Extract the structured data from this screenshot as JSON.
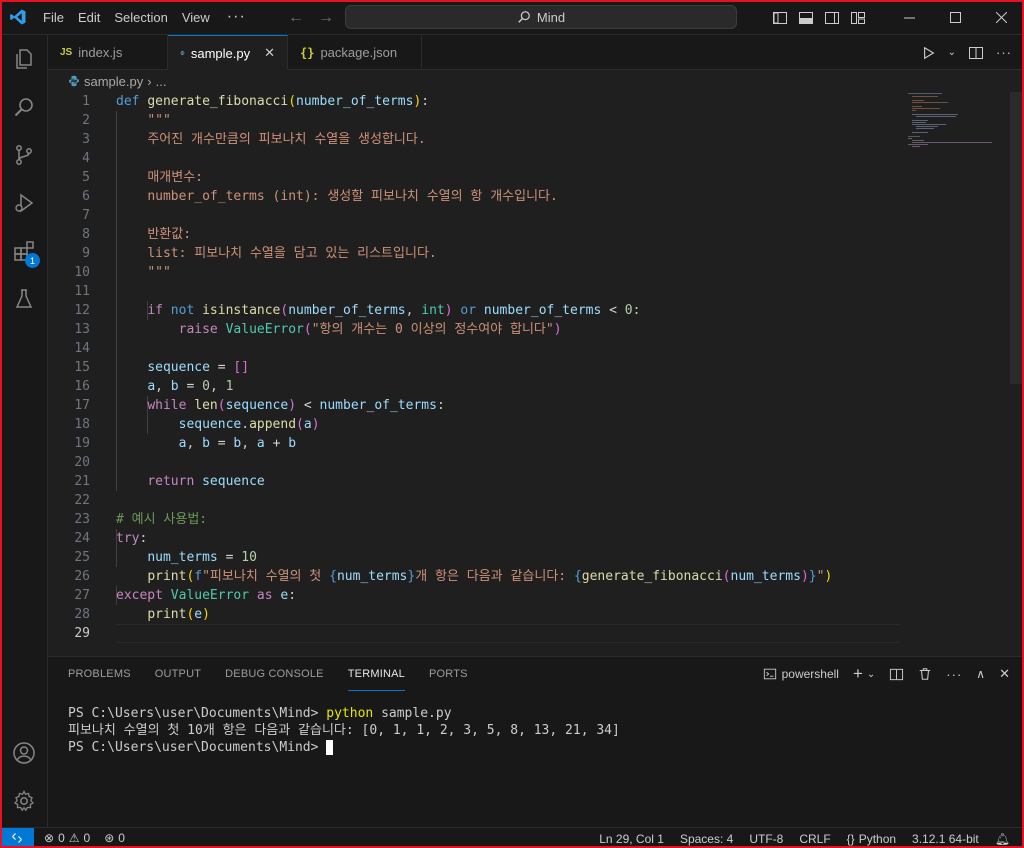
{
  "menu": {
    "items": [
      "File",
      "Edit",
      "Selection",
      "View"
    ],
    "more": "···"
  },
  "command_center": {
    "text": "Mind"
  },
  "tabs": [
    {
      "label": "index.js",
      "badge": "JS"
    },
    {
      "label": "sample.py",
      "active": true
    },
    {
      "label": "package.json",
      "badge": "{}"
    }
  ],
  "breadcrumb": {
    "file": "sample.py",
    "more": "..."
  },
  "activity": {
    "extensions_badge": "1"
  },
  "editor": {
    "line_numbers": [
      "1",
      "2",
      "3",
      "4",
      "5",
      "6",
      "7",
      "8",
      "9",
      "10",
      "11",
      "12",
      "13",
      "14",
      "15",
      "16",
      "17",
      "18",
      "19",
      "20",
      "21",
      "22",
      "23",
      "24",
      "25",
      "26",
      "27",
      "28",
      "29"
    ],
    "doc_lines": [
      "주어진 개수만큼의 피보나치 수열을 생성합니다.",
      "매개변수:",
      "number_of_terms (int): 생성할 피보나치 수열의 항 개수입니다.",
      "반환값:",
      "list: 피보나치 수열을 담고 있는 리스트입니다.",
      "\"\"\""
    ],
    "raise_message": "\"항의 개수는 0 이상의 정수여야 합니다\"",
    "comment": "# 예시 사용법:",
    "print_text": "\"피보나치 수열의 첫 ",
    "print_mid": "개 항은 다음과 같습니다: "
  },
  "panel": {
    "tabs": [
      "PROBLEMS",
      "OUTPUT",
      "DEBUG CONSOLE",
      "TERMINAL",
      "PORTS"
    ],
    "active_tab": "TERMINAL",
    "shell": "powershell",
    "terminal": {
      "prompt": "PS C:\\Users\\user\\Documents\\Mind> ",
      "command": "python",
      "args": " sample.py",
      "output": "피보나치 수열의 첫 10개 항은 다음과 같습니다: [0, 1, 1, 2, 3, 5, 8, 13, 21, 34]"
    }
  },
  "status": {
    "errors": "0",
    "warnings": "0",
    "ports": "0",
    "position": "Ln 29, Col 1",
    "spaces": "Spaces: 4",
    "encoding": "UTF-8",
    "eol": "CRLF",
    "language": "Python",
    "interpreter": "3.12.1 64-bit"
  },
  "colors": {
    "accent": "#0078d4",
    "frame": "#e81123",
    "background": "#1f1f1f"
  }
}
